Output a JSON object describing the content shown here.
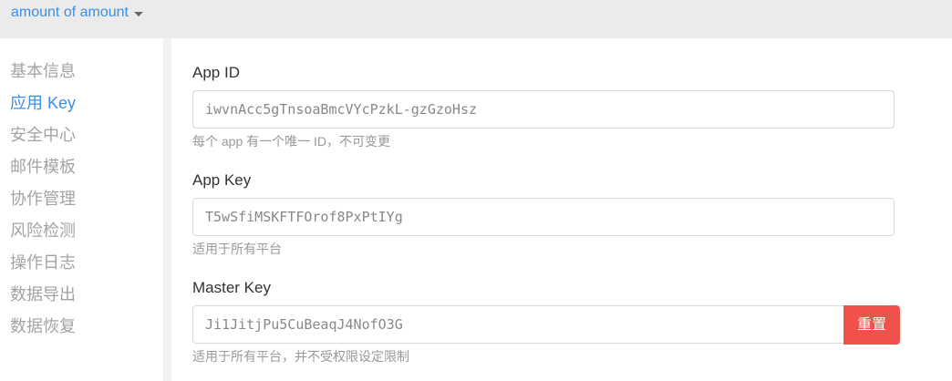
{
  "app_switcher": {
    "label": "amount of amount",
    "icon": "caret-down-icon"
  },
  "sidebar": {
    "items": [
      {
        "label": "基本信息",
        "active": false
      },
      {
        "label": "应用 Key",
        "active": true
      },
      {
        "label": "安全中心",
        "active": false
      },
      {
        "label": "邮件模板",
        "active": false
      },
      {
        "label": "协作管理",
        "active": false
      },
      {
        "label": "风险检测",
        "active": false
      },
      {
        "label": "操作日志",
        "active": false
      },
      {
        "label": "数据导出",
        "active": false
      },
      {
        "label": "数据恢复",
        "active": false
      }
    ]
  },
  "fields": {
    "app_id": {
      "label": "App ID",
      "value": "iwvnAcc5gTnsoaBmcVYcPzkL-gzGzoHsz",
      "help": "每个 app 有一个唯一 ID，不可变更"
    },
    "app_key": {
      "label": "App Key",
      "value": "T5wSfiMSKFTFOrof8PxPtIYg",
      "help": "适用于所有平台"
    },
    "master_key": {
      "label": "Master Key",
      "value": "Ji1JitjPu5CuBeaqJ4NofO3G",
      "help": "适用于所有平台，并不受权限设定限制",
      "reset_label": "重置"
    }
  },
  "colors": {
    "accent": "#3a8ee6",
    "danger": "#f0524b",
    "topbar_bg": "#ebebeb"
  }
}
